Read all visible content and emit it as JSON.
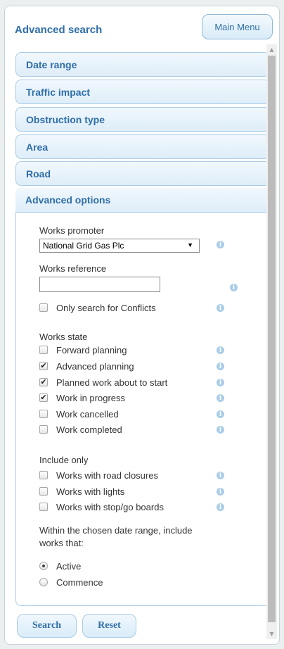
{
  "panel": {
    "title": "Advanced search",
    "main_menu_label": "Main Menu"
  },
  "sections": [
    {
      "label": "Date range"
    },
    {
      "label": "Traffic impact"
    },
    {
      "label": "Obstruction type"
    },
    {
      "label": "Area"
    },
    {
      "label": "Road"
    },
    {
      "label": "Advanced options"
    }
  ],
  "advanced": {
    "works_promoter_label": "Works promoter",
    "works_promoter_value": "National Grid Gas Plc",
    "works_reference_label": "Works reference",
    "works_reference_value": "",
    "conflicts_label": "Only search for Conflicts",
    "conflicts_checked": false,
    "works_state_label": "Works state",
    "works_state": [
      {
        "label": "Forward planning",
        "checked": false
      },
      {
        "label": "Advanced planning",
        "checked": true
      },
      {
        "label": "Planned work about to start",
        "checked": true
      },
      {
        "label": "Work in progress",
        "checked": true
      },
      {
        "label": "Work cancelled",
        "checked": false
      },
      {
        "label": "Work completed",
        "checked": false
      }
    ],
    "include_only_label": "Include only",
    "include_only": [
      {
        "label": "Works with road closures",
        "checked": false
      },
      {
        "label": "Works with lights",
        "checked": false
      },
      {
        "label": "Works with stop/go boards",
        "checked": false
      }
    ],
    "date_range_note_line1": "Within the chosen date range, include",
    "date_range_note_line2": "works that:",
    "radio_options": [
      {
        "label": "Active",
        "selected": true
      },
      {
        "label": "Commence",
        "selected": false
      }
    ]
  },
  "footer": {
    "search_label": "Search",
    "reset_label": "Reset"
  },
  "icons": {
    "info": "i",
    "checkmark": "✔",
    "dropdown": "▼",
    "scroll_up": "▲",
    "scroll_down": "▼"
  },
  "colors": {
    "accent": "#2f6ea8",
    "header_bg": "#deedf8",
    "info_icon": "#a9cde8"
  }
}
